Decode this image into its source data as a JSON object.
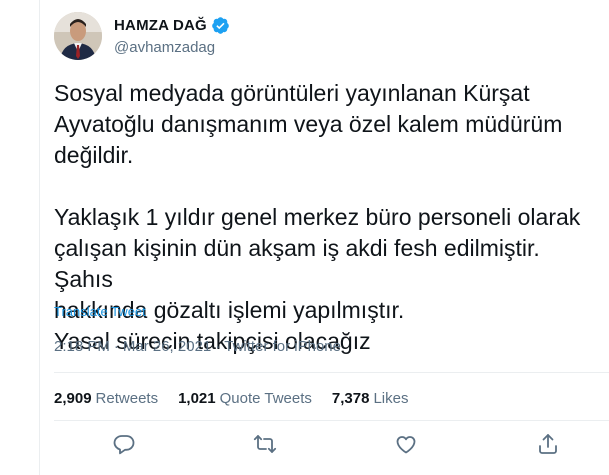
{
  "author": {
    "display_name": "HAMZA DAĞ",
    "handle": "@avhamzadag",
    "verified": true
  },
  "tweet": {
    "paragraphs": [
      [
        "Sosyal medyada görüntüleri yayınlanan Kürşat",
        "Ayvatoğlu danışmanım veya özel kalem müdürüm",
        "değildir."
      ],
      [
        "Yaklaşık 1 yıldır genel merkez büro personeli olarak",
        "çalışan kişinin dün akşam iş akdi fesh edilmiştir. Şahıs",
        "hakkında gözaltı işlemi yapılmıştır.",
        "Yasal sürecin takipçisi olacağız"
      ]
    ],
    "translate_label": "Translate Tweet",
    "time": "2:18 PM",
    "date": "Mar 26, 2021",
    "source": "Twitter for iPhone",
    "separator": "·"
  },
  "stats": {
    "retweets_count": "2,909",
    "retweets_label": "Retweets",
    "quotes_count": "1,021",
    "quotes_label": "Quote Tweets",
    "likes_count": "7,378",
    "likes_label": "Likes"
  },
  "actions": [
    "reply-icon",
    "retweet-icon",
    "like-icon",
    "share-icon"
  ],
  "colors": {
    "link": "#1b95e0",
    "muted": "#5b7083",
    "verified": "#1da1f2",
    "divider": "#ebeef0"
  }
}
